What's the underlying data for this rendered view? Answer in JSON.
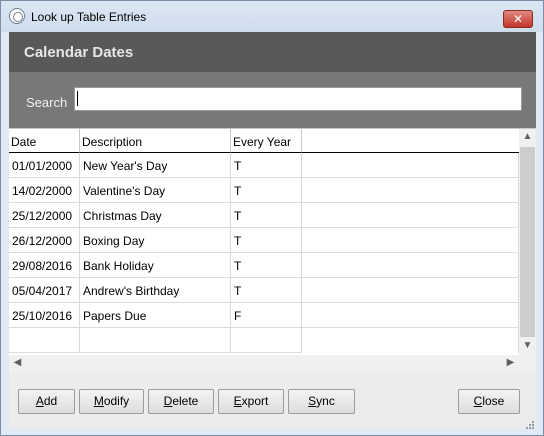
{
  "window": {
    "title": "Look up Table Entries",
    "close_glyph": "✕"
  },
  "header": {
    "title": "Calendar Dates"
  },
  "search": {
    "label": "Search",
    "value": "",
    "placeholder": ""
  },
  "table": {
    "columns": [
      "Date",
      "Description",
      "Every Year"
    ],
    "rows": [
      [
        "01/01/2000",
        "New Year's Day",
        "T"
      ],
      [
        "14/02/2000",
        "Valentine's Day",
        "T"
      ],
      [
        "25/12/2000",
        "Christmas Day",
        "T"
      ],
      [
        "26/12/2000",
        "Boxing Day",
        "T"
      ],
      [
        "29/08/2016",
        "Bank Holiday",
        "T"
      ],
      [
        "05/04/2017",
        "Andrew's Birthday",
        "T"
      ],
      [
        "25/10/2016",
        "Papers Due",
        "F"
      ]
    ]
  },
  "buttons": {
    "add": {
      "hotkey": "A",
      "rest": "dd"
    },
    "modify": {
      "hotkey": "M",
      "rest": "odify"
    },
    "delete": {
      "hotkey": "D",
      "rest": "elete"
    },
    "export": {
      "hotkey": "E",
      "rest": "xport"
    },
    "sync": {
      "hotkey": "S",
      "rest": "ync"
    },
    "close": {
      "hotkey": "C",
      "rest": "lose"
    }
  },
  "icons": {
    "app": "app-icon",
    "close": "close-icon",
    "scroll_up": "scroll-up-arrow-icon",
    "scroll_down": "scroll-down-arrow-icon",
    "scroll_left": "scroll-left-arrow-icon",
    "scroll_right": "scroll-right-arrow-icon",
    "resize": "resize-grip-icon"
  },
  "colors": {
    "header_band": "#595959",
    "search_band": "#787878",
    "close_button": "#c2352b"
  }
}
